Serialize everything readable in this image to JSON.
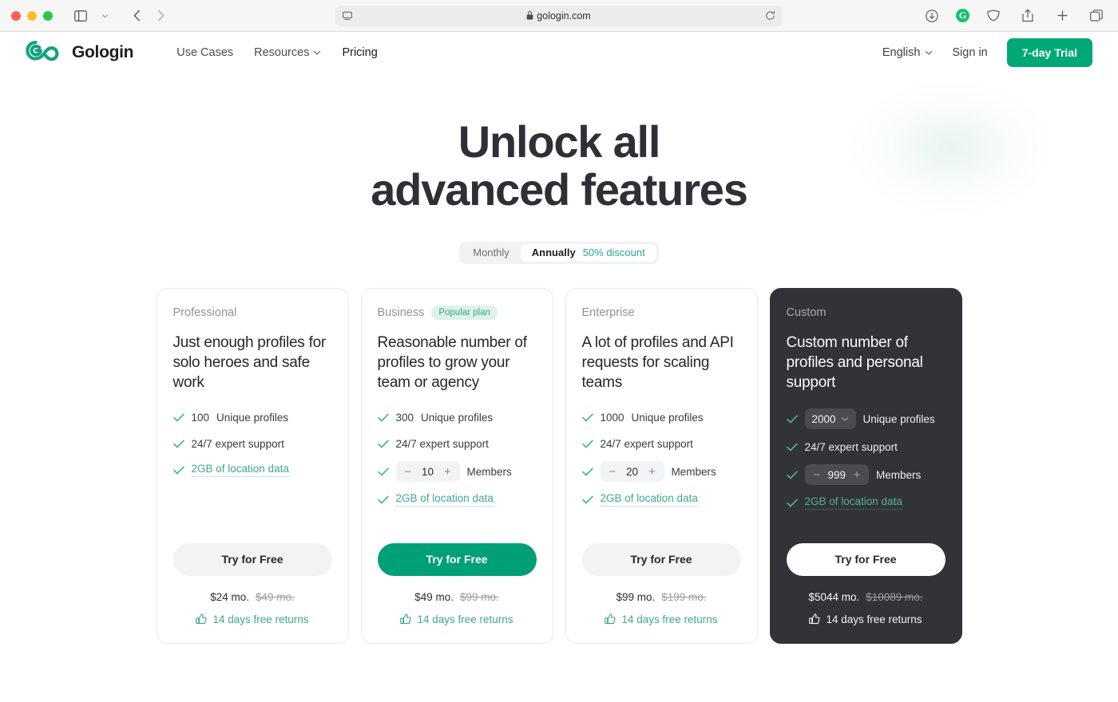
{
  "browser": {
    "url": "gologin.com",
    "icons": {
      "sidebar": "sidebar-toggle-icon",
      "back": "back-arrow-icon",
      "forward": "forward-arrow-icon",
      "lock": "lock-icon",
      "reload": "reload-icon",
      "downloads": "downloads-icon",
      "grammarly": "G",
      "vpn": "vpn-shield-icon",
      "share": "share-icon",
      "new_tab": "plus-icon",
      "tab_overview": "tab-overview-icon"
    }
  },
  "header": {
    "brand": "Gologin",
    "nav": [
      {
        "label": "Use Cases",
        "has_caret": false,
        "active": false
      },
      {
        "label": "Resources",
        "has_caret": true,
        "active": false
      },
      {
        "label": "Pricing",
        "has_caret": false,
        "active": true
      }
    ],
    "language": "English",
    "sign_in": "Sign in",
    "trial_button": "7-day Trial"
  },
  "hero": {
    "line1": "Unlock all",
    "line2": "advanced features"
  },
  "billing_toggle": {
    "monthly": "Monthly",
    "annually": "Annually",
    "discount": "50% discount",
    "selected": "Annually"
  },
  "colors": {
    "accent": "#00a077",
    "accent_text": "#3fa98c",
    "badge_bg": "#ddf3e8",
    "badge_text": "#3aa380",
    "dark_card": "#323338",
    "heading": "#2f3037"
  },
  "cards": [
    {
      "plan": "Professional",
      "badge": null,
      "tagline": "Just enough profiles for solo heroes and safe work",
      "features": [
        {
          "type": "value",
          "value": "100",
          "label": "Unique profiles"
        },
        {
          "type": "text",
          "label": "24/7 expert support"
        },
        {
          "type": "link",
          "label": "2GB of location data"
        }
      ],
      "cta": "Try for Free",
      "price": "$24 mo.",
      "price_old": "$49 mo.",
      "returns": "14 days free returns"
    },
    {
      "plan": "Business",
      "badge": "Popular plan",
      "tagline": "Reasonable number of profiles to grow your team or agency",
      "features": [
        {
          "type": "value",
          "value": "300",
          "label": "Unique profiles"
        },
        {
          "type": "text",
          "label": "24/7 expert support"
        },
        {
          "type": "stepper",
          "value": "10",
          "label": "Members",
          "minus": "−",
          "plus": "+"
        },
        {
          "type": "link",
          "label": "2GB of location data"
        }
      ],
      "cta": "Try for Free",
      "price": "$49 mo.",
      "price_old": "$99 mo.",
      "returns": "14 days free returns"
    },
    {
      "plan": "Enterprise",
      "badge": null,
      "tagline": "A lot of profiles and API requests for scaling teams",
      "features": [
        {
          "type": "value",
          "value": "1000",
          "label": "Unique profiles"
        },
        {
          "type": "text",
          "label": "24/7 expert support"
        },
        {
          "type": "stepper",
          "value": "20",
          "label": "Members",
          "minus": "−",
          "plus": "+"
        },
        {
          "type": "link",
          "label": "2GB of location data"
        }
      ],
      "cta": "Try for Free",
      "price": "$99 mo.",
      "price_old": "$199 mo.",
      "returns": "14 days free returns"
    },
    {
      "plan": "Custom",
      "badge": null,
      "tagline": "Custom number of profiles and personal support",
      "features": [
        {
          "type": "select",
          "value": "2000",
          "label": "Unique profiles"
        },
        {
          "type": "text",
          "label": "24/7 expert support"
        },
        {
          "type": "stepper",
          "value": "999",
          "label": "Members",
          "minus": "−",
          "plus": "+"
        },
        {
          "type": "link",
          "label": "2GB of location data"
        }
      ],
      "cta": "Try for Free",
      "price": "$5044 mo.",
      "price_old": "$10089 mo.",
      "returns": "14 days free returns"
    }
  ]
}
